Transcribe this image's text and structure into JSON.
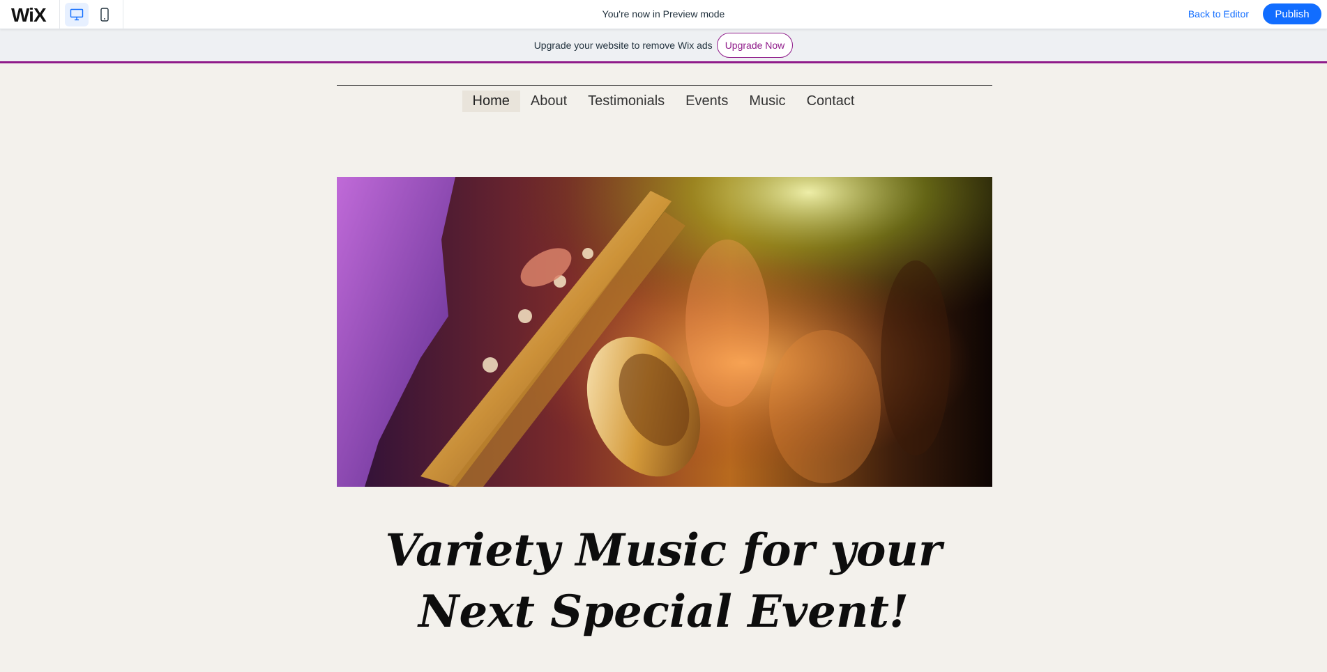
{
  "app": {
    "logo_text": "WiX"
  },
  "topbar": {
    "preview_message": "You're now in Preview mode",
    "back_to_editor": "Back to Editor",
    "publish": "Publish",
    "icons": {
      "desktop": "desktop-icon",
      "mobile": "mobile-icon"
    }
  },
  "upgrade_banner": {
    "text": "Upgrade your website to remove Wix ads",
    "button": "Upgrade Now",
    "accent_color": "#8f1b8a"
  },
  "site": {
    "nav": [
      {
        "label": "Home",
        "active": true
      },
      {
        "label": "About"
      },
      {
        "label": "Testimonials"
      },
      {
        "label": "Events"
      },
      {
        "label": "Music"
      },
      {
        "label": "Contact"
      }
    ],
    "headline_line1": "Variety Music for your",
    "headline_line2": "Next Special Event!",
    "background_color": "#f3f1ec"
  },
  "colors": {
    "primary": "#116dff"
  }
}
